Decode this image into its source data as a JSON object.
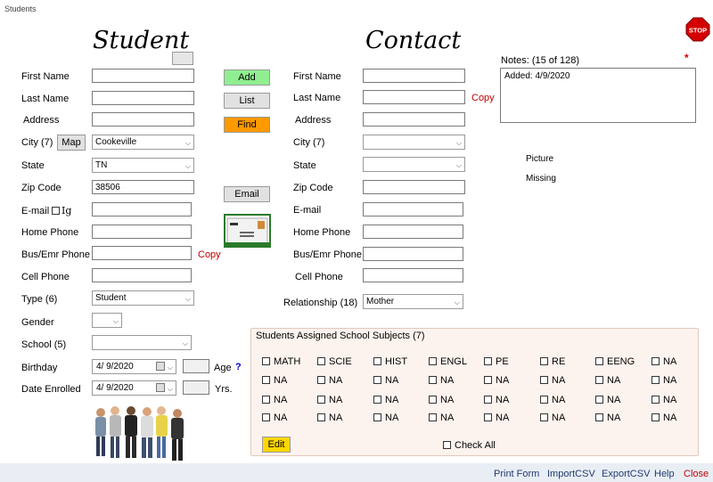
{
  "window": {
    "title": "Students"
  },
  "student": {
    "heading": "Student",
    "first_name_label": "First Name",
    "last_name_label": "Last Name",
    "address_label": "Address",
    "city_label": "City (7)",
    "map_button": "Map",
    "city_value": "Cookeville",
    "state_label": "State",
    "state_value": "TN",
    "zip_label": "Zip Code",
    "zip_value": "38506",
    "email_label": "E-mail",
    "ig_label": "Ig",
    "home_phone_label": "Home Phone",
    "bus_phone_label": "Bus/Emr Phone",
    "copy_label": "Copy",
    "cell_phone_label": "Cell Phone",
    "type_label": "Type (6)",
    "type_value": "Student",
    "gender_label": "Gender",
    "school_label": "School (5)",
    "birthday_label": "Birthday",
    "birthday_value": "4/  9/2020",
    "age_label": "Age",
    "help_mark": "?",
    "enrolled_label": "Date Enrolled",
    "enrolled_value": "4/  9/2020",
    "yrs_label": "Yrs."
  },
  "actions": {
    "add": "Add",
    "list": "List",
    "find": "Find",
    "email": "Email"
  },
  "contact": {
    "heading": "Contact",
    "first_name_label": "First Name",
    "last_name_label": "Last Name",
    "copy_label": "Copy",
    "address_label": "Address",
    "city_label": "City (7)",
    "state_label": "State",
    "zip_label": "Zip Code",
    "email_label": "E-mail",
    "home_phone_label": "Home Phone",
    "bus_phone_label": "Bus/Emr Phone",
    "cell_phone_label": "Cell Phone",
    "relationship_label": "Relationship (18)",
    "relationship_value": "Mother"
  },
  "notes": {
    "label": "Notes: (15 of 128)",
    "content": "Added: 4/9/2020",
    "marker": "*"
  },
  "picture": {
    "line1": "Picture",
    "line2": "Missing"
  },
  "stop_label": "STOP",
  "subjects": {
    "title": "Students Assigned School Subjects (7)",
    "rows": [
      [
        "MATH",
        "SCIE",
        "HIST",
        "ENGL",
        "PE",
        "RE",
        "EENG",
        "NA"
      ],
      [
        "NA",
        "NA",
        "NA",
        "NA",
        "NA",
        "NA",
        "NA",
        "NA"
      ],
      [
        "NA",
        "NA",
        "NA",
        "NA",
        "NA",
        "NA",
        "NA",
        "NA"
      ],
      [
        "NA",
        "NA",
        "NA",
        "NA",
        "NA",
        "NA",
        "NA",
        "NA"
      ]
    ],
    "edit_button": "Edit",
    "check_all": "Check All"
  },
  "footer": {
    "print": "Print Form",
    "import": "ImportCSV",
    "export": "ExportCSV",
    "help": "Help",
    "close": "Close"
  },
  "colors": {
    "add_btn": "#90ee90",
    "find_btn": "#ff9900",
    "edit_btn": "#ffd700",
    "copy_text": "#c00000",
    "subjects_bg": "#fdf3ee"
  }
}
